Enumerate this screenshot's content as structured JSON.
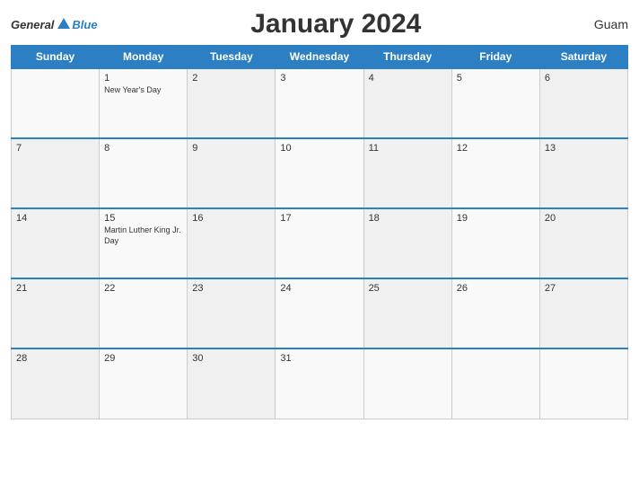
{
  "header": {
    "logo_general": "General",
    "logo_blue": "Blue",
    "title": "January 2024",
    "region": "Guam"
  },
  "days_of_week": [
    "Sunday",
    "Monday",
    "Tuesday",
    "Wednesday",
    "Thursday",
    "Friday",
    "Saturday"
  ],
  "weeks": [
    [
      {
        "day": "",
        "event": ""
      },
      {
        "day": "1",
        "event": "New Year's Day"
      },
      {
        "day": "2",
        "event": ""
      },
      {
        "day": "3",
        "event": ""
      },
      {
        "day": "4",
        "event": ""
      },
      {
        "day": "5",
        "event": ""
      },
      {
        "day": "6",
        "event": ""
      }
    ],
    [
      {
        "day": "7",
        "event": ""
      },
      {
        "day": "8",
        "event": ""
      },
      {
        "day": "9",
        "event": ""
      },
      {
        "day": "10",
        "event": ""
      },
      {
        "day": "11",
        "event": ""
      },
      {
        "day": "12",
        "event": ""
      },
      {
        "day": "13",
        "event": ""
      }
    ],
    [
      {
        "day": "14",
        "event": ""
      },
      {
        "day": "15",
        "event": "Martin Luther King Jr. Day"
      },
      {
        "day": "16",
        "event": ""
      },
      {
        "day": "17",
        "event": ""
      },
      {
        "day": "18",
        "event": ""
      },
      {
        "day": "19",
        "event": ""
      },
      {
        "day": "20",
        "event": ""
      }
    ],
    [
      {
        "day": "21",
        "event": ""
      },
      {
        "day": "22",
        "event": ""
      },
      {
        "day": "23",
        "event": ""
      },
      {
        "day": "24",
        "event": ""
      },
      {
        "day": "25",
        "event": ""
      },
      {
        "day": "26",
        "event": ""
      },
      {
        "day": "27",
        "event": ""
      }
    ],
    [
      {
        "day": "28",
        "event": ""
      },
      {
        "day": "29",
        "event": ""
      },
      {
        "day": "30",
        "event": ""
      },
      {
        "day": "31",
        "event": ""
      },
      {
        "day": "",
        "event": ""
      },
      {
        "day": "",
        "event": ""
      },
      {
        "day": "",
        "event": ""
      }
    ]
  ]
}
